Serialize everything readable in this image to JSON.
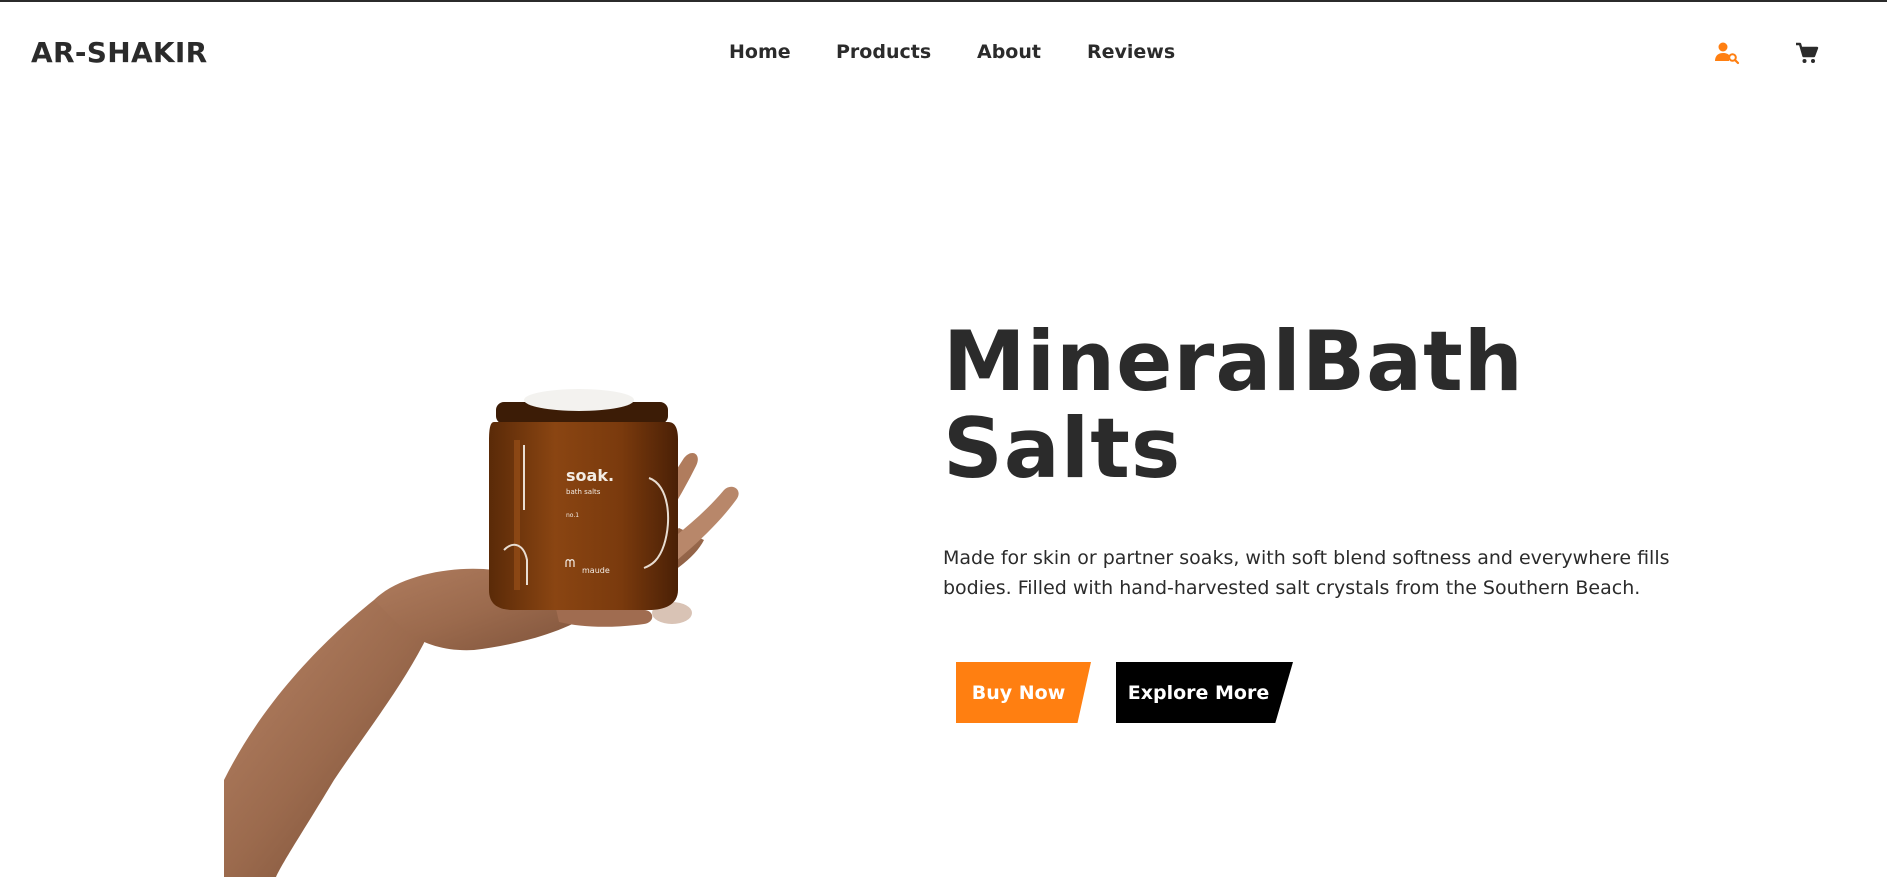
{
  "header": {
    "brand": "AR-SHAKIR",
    "nav": [
      "Home",
      "Products",
      "About",
      "Reviews"
    ],
    "icons": {
      "account": "user-search-icon",
      "cart": "shopping-cart-icon"
    }
  },
  "hero": {
    "title_line1": "MineralBath",
    "title_line2": "Salts",
    "description": "Made for skin or partner soaks, with soft blend softness and everywhere fills bodies. Filled with hand-harvested salt crystals from the Southern Beach.",
    "buy_label": "Buy Now",
    "explore_label": "Explore More",
    "product_jar": {
      "name": "soak.",
      "subtitle": "bath salts",
      "number": "no.1",
      "brand": "maude"
    }
  },
  "colors": {
    "text": "#2b2b2b",
    "accent": "#ff7f11",
    "dark_button": "#000000",
    "background": "#ffffff"
  }
}
